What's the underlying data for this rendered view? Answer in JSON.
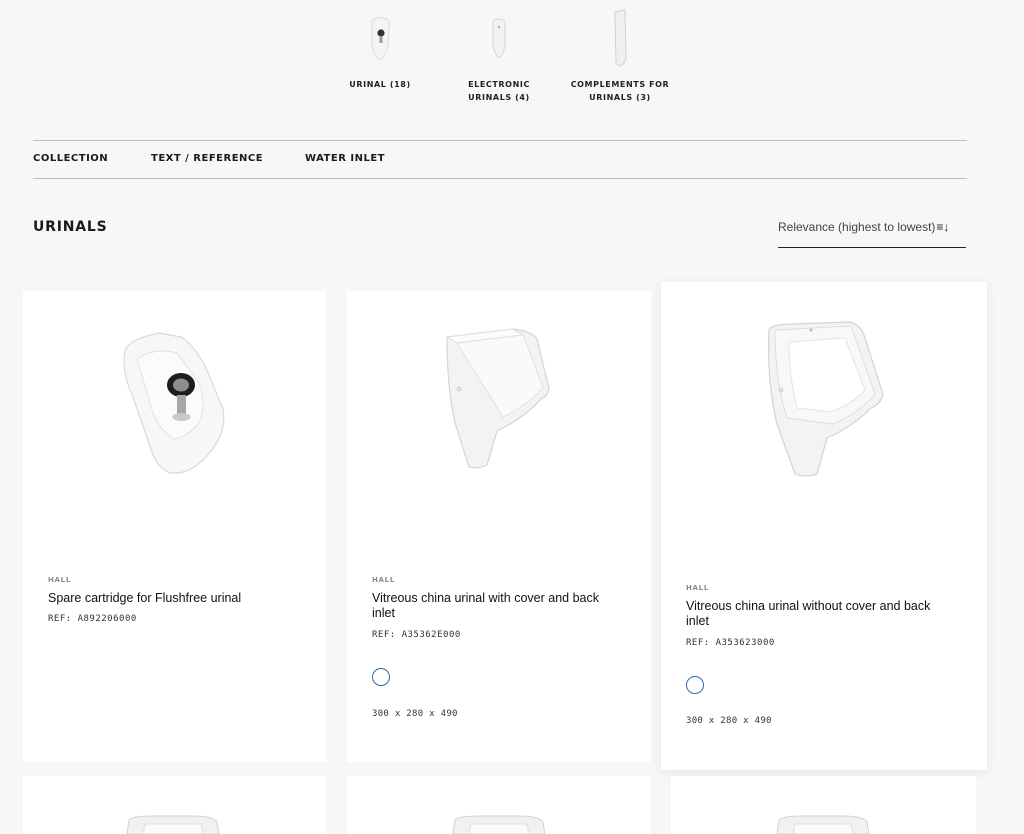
{
  "categories": [
    {
      "label": "URINAL (18)",
      "icon": "urinal-icon"
    },
    {
      "label_line1": "ELECTRONIC",
      "label_line2": "URINALS (4)",
      "icon": "electronic-urinal-icon"
    },
    {
      "label_line1": "COMPLEMENTS FOR",
      "label_line2": "URINALS (3)",
      "icon": "urinal-divider-icon"
    }
  ],
  "filters": [
    "COLLECTION",
    "TEXT / REFERENCE",
    "WATER INLET"
  ],
  "page_title": "URINALS",
  "sort": {
    "label": "Relevance (highest to lowest)",
    "icon": "sort-desc-icon"
  },
  "products": [
    {
      "brand": "HALL",
      "name": "Spare cartridge for Flushfree urinal",
      "ref": "REF: A892206000",
      "finish_color": null,
      "dimensions": null
    },
    {
      "brand": "HALL",
      "name_line1": "Vitreous china urinal with cover and back",
      "name_line2": "inlet",
      "ref": "REF: A35362E000",
      "finish_color": "#ffffff",
      "dimensions": "300 x 280 x 490"
    },
    {
      "brand": "HALL",
      "name_line1": "Vitreous china urinal without cover and back",
      "name_line2": "inlet",
      "ref": "REF: A353623000",
      "finish_color": "#ffffff",
      "dimensions": "300 x 280 x 490"
    }
  ],
  "colors": {
    "swatch_border": "#2b6cb0",
    "background": "#f7f7f7",
    "card": "#ffffff"
  }
}
